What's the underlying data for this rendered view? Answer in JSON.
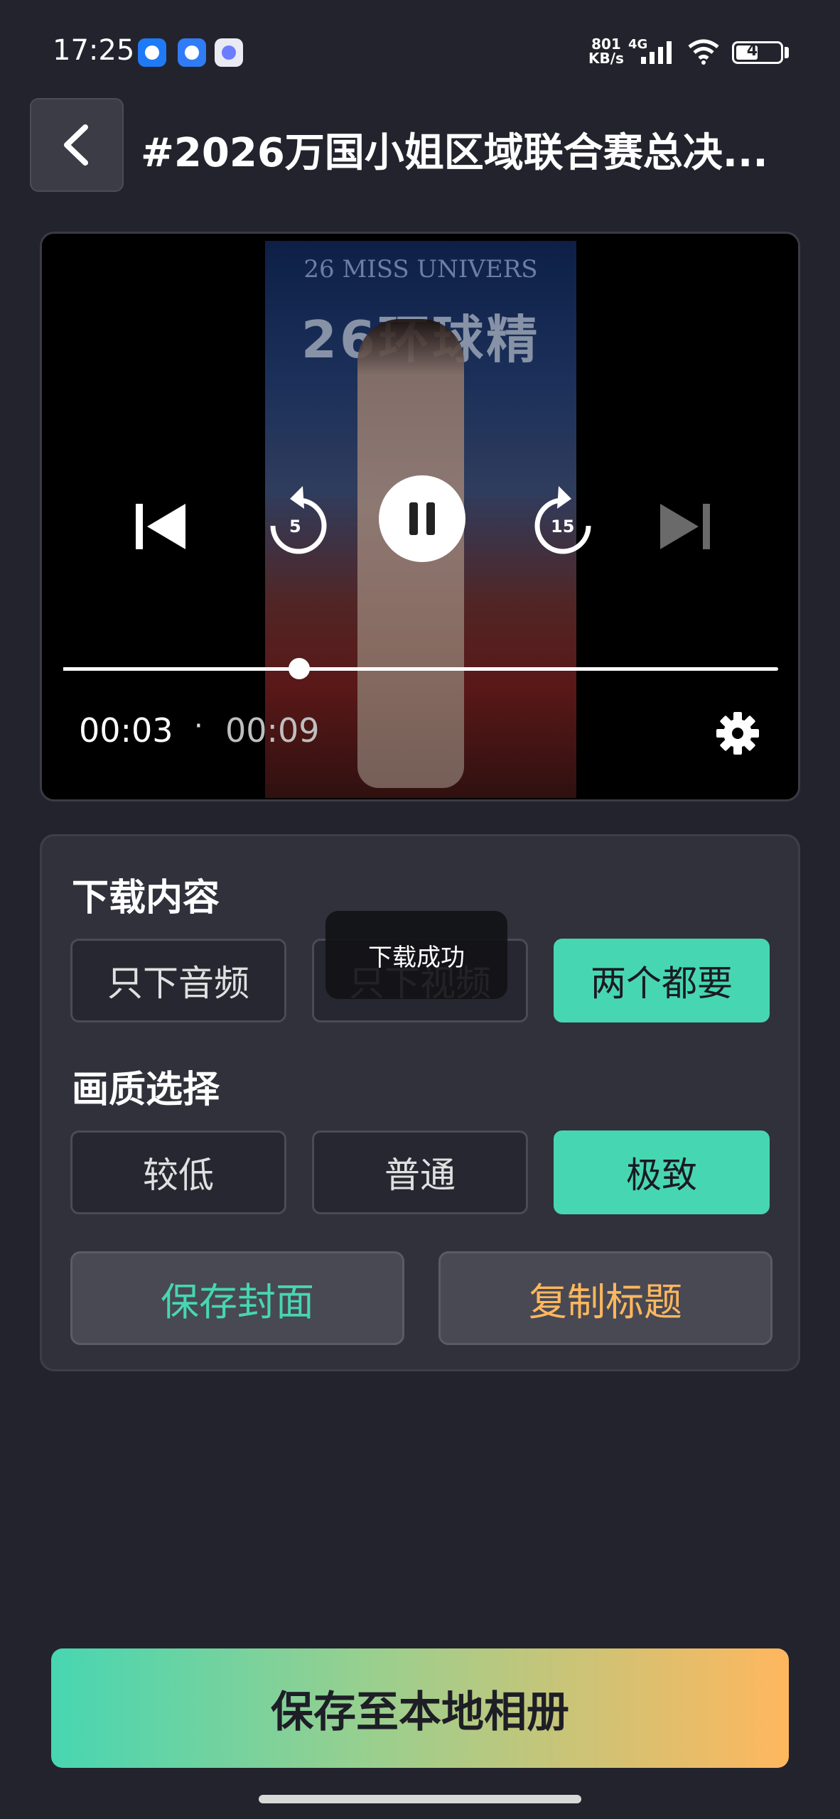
{
  "status_bar": {
    "time": "17:25",
    "net_speed_value": "801",
    "net_speed_unit": "KB/s",
    "network_type": "4G",
    "battery_level": "46",
    "apps": [
      "qq-icon",
      "browser-icon",
      "game-icon"
    ]
  },
  "header": {
    "title": "#2026万国小姐区域联合赛总决..."
  },
  "video": {
    "banner_en": "26 MISS UNIVERS",
    "banner_cn": "26环球精"
  },
  "player": {
    "current_time": "00:03",
    "separator": "·",
    "total_time": "00:09",
    "progress": 0.33,
    "rewind_seconds": "5",
    "forward_seconds": "15",
    "state": "playing"
  },
  "download": {
    "section_label": "下载内容",
    "options": [
      "只下音频",
      "只下视频",
      "两个都要"
    ],
    "selected": "两个都要"
  },
  "quality": {
    "section_label": "画质选择",
    "options": [
      "较低",
      "普通",
      "极致"
    ],
    "selected": "极致"
  },
  "actions": {
    "save_cover": "保存封面",
    "copy_title": "复制标题"
  },
  "toast": {
    "message": "下载成功"
  },
  "footer": {
    "save_to_album": "保存至本地相册"
  },
  "colors": {
    "background": "#23232d",
    "accent_green": "#47d6b2",
    "accent_orange": "#ffb75e",
    "card": "#30313b"
  }
}
